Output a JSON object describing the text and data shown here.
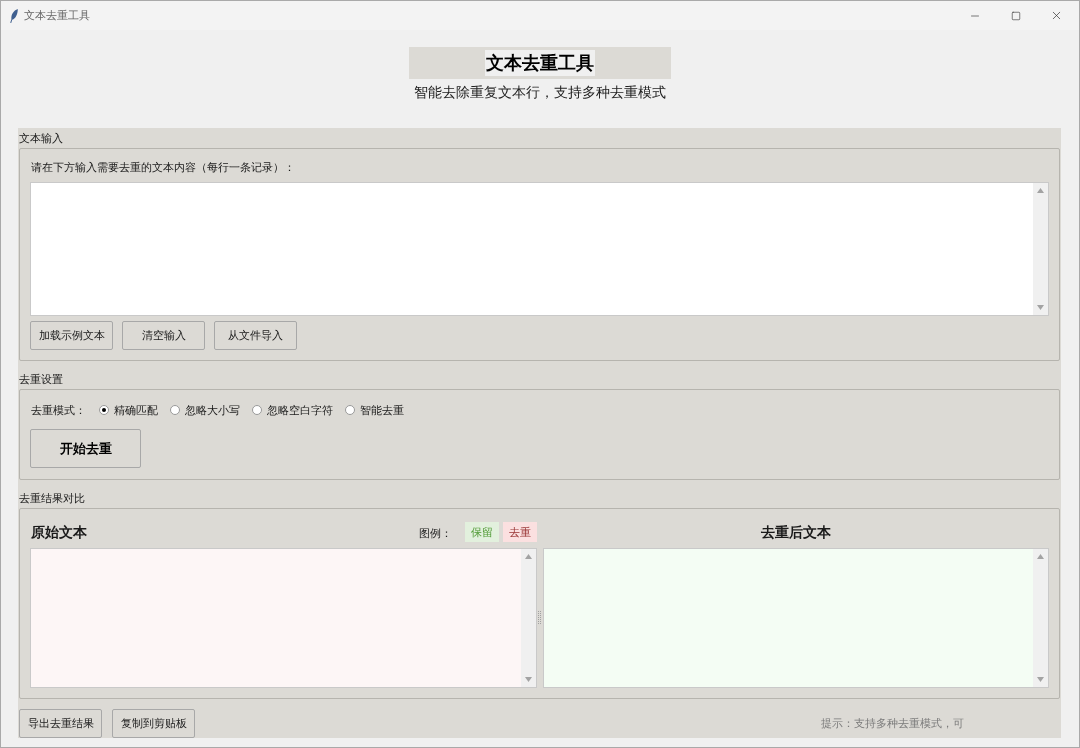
{
  "window": {
    "title": "文本去重工具"
  },
  "header": {
    "title": "文本去重工具",
    "subtitle": "智能去除重复文本行，支持多种去重模式"
  },
  "input_section": {
    "label": "文本输入",
    "instruction": "请在下方输入需要去重的文本内容（每行一条记录）：",
    "buttons": [
      "加载示例文本",
      "清空输入",
      "从文件导入"
    ]
  },
  "settings_section": {
    "label": "去重设置",
    "mode_label": "去重模式：",
    "modes": [
      {
        "label": "精确匹配",
        "selected": true
      },
      {
        "label": "忽略大小写",
        "selected": false
      },
      {
        "label": "忽略空白字符",
        "selected": false
      },
      {
        "label": "智能去重",
        "selected": false
      }
    ],
    "start_button": "开始去重"
  },
  "results_section": {
    "label": "去重结果对比",
    "original_title": "原始文本",
    "legend_label": "图例：",
    "legend": [
      {
        "label": "保留",
        "color": "#e2f0dd"
      },
      {
        "label": "去重",
        "color": "#fbe0e0"
      }
    ],
    "result_title": "去重后文本"
  },
  "footer": {
    "buttons": [
      "导出去重结果",
      "复制到剪贴板"
    ],
    "hint": "提示：支持多种去重模式，可"
  }
}
